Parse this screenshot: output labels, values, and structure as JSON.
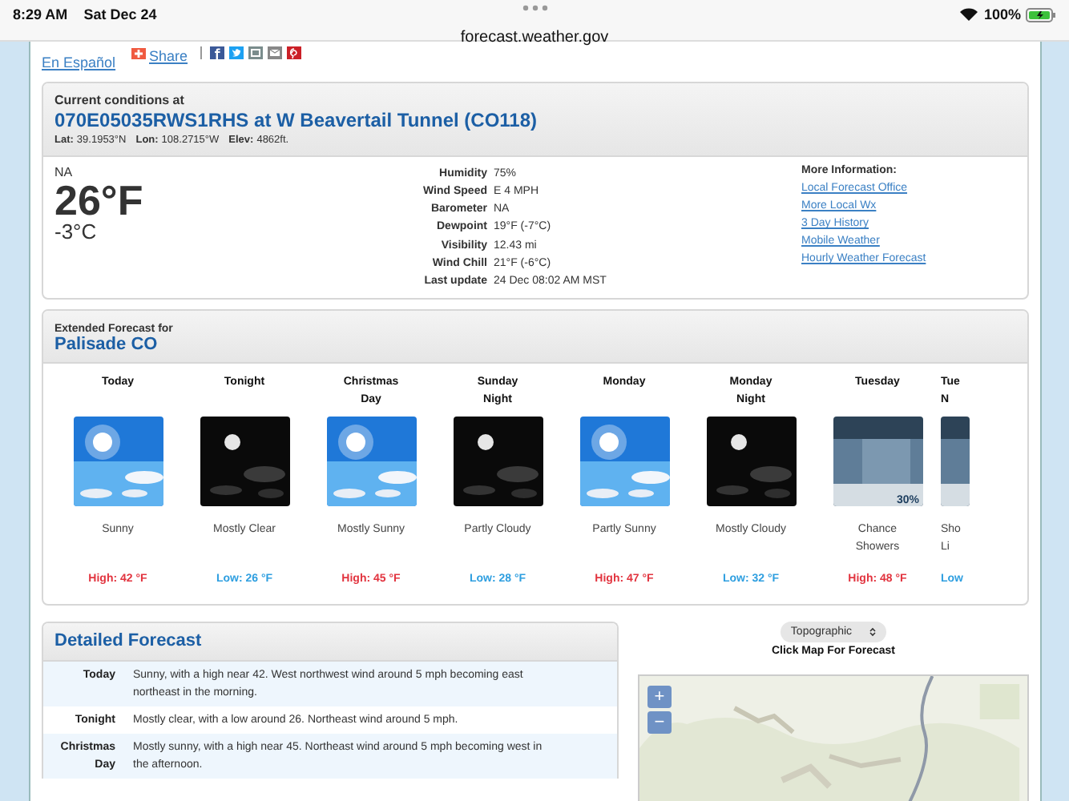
{
  "status_bar": {
    "time": "8:29 AM",
    "date": "Sat Dec 24",
    "battery": "100%",
    "url": "forecast.weather.gov"
  },
  "share": {
    "label": "Share"
  },
  "language_link": "En Español",
  "current_conditions": {
    "heading": "Current conditions at",
    "station": "070E05035RWS1RHS at W Beavertail Tunnel (CO118)",
    "location": [
      {
        "label": "Lat:",
        "value": "39.1953°N"
      },
      {
        "label": "Lon:",
        "value": "108.2715°W"
      },
      {
        "label": "Elev:",
        "value": "4862ft."
      }
    ],
    "condition": "NA",
    "temp_f": "26°F",
    "temp_c": "-3°C",
    "details": [
      {
        "label": "Humidity",
        "value": "75%"
      },
      {
        "label": "Wind Speed",
        "value": "E 4 MPH"
      },
      {
        "label": "Barometer",
        "value": "NA"
      },
      {
        "label": "Dewpoint",
        "value": "19°F (-7°C)"
      },
      {
        "label": "Visibility",
        "value": "12.43 mi"
      },
      {
        "label": "Wind Chill",
        "value": "21°F (-6°C)"
      },
      {
        "label": "Last update",
        "value": "24 Dec 08:02 AM MST"
      }
    ],
    "more_info": {
      "heading": "More Information:",
      "links": [
        "Local Forecast Office",
        "More Local Wx",
        "3 Day History",
        "Mobile Weather",
        "Hourly Weather Forecast"
      ]
    }
  },
  "extended_forecast": {
    "heading": "Extended Forecast for",
    "place": "Palisade CO",
    "periods": [
      {
        "name": [
          "Today"
        ],
        "kind": "day",
        "forecast": [
          "Sunny"
        ],
        "temp": "High: 42 °F",
        "color": "#e2343f"
      },
      {
        "name": [
          "Tonight"
        ],
        "kind": "night",
        "forecast": [
          "Mostly Clear"
        ],
        "temp": "Low: 26 °F",
        "color": "#2f9fe0"
      },
      {
        "name": [
          "Christmas",
          "Day"
        ],
        "kind": "day",
        "forecast": [
          "Mostly Sunny"
        ],
        "temp": "High: 45 °F",
        "color": "#e2343f"
      },
      {
        "name": [
          "Sunday",
          "Night"
        ],
        "kind": "night",
        "forecast": [
          "Partly Cloudy"
        ],
        "temp": "Low: 28 °F",
        "color": "#2f9fe0"
      },
      {
        "name": [
          "Monday"
        ],
        "kind": "day",
        "forecast": [
          "Partly Sunny"
        ],
        "temp": "High: 47 °F",
        "color": "#e2343f"
      },
      {
        "name": [
          "Monday",
          "Night"
        ],
        "kind": "night",
        "forecast": [
          "Mostly Cloudy"
        ],
        "temp": "Low: 32 °F",
        "color": "#2f9fe0"
      },
      {
        "name": [
          "Tuesday"
        ],
        "kind": "rain",
        "forecast": [
          "Chance",
          "Showers"
        ],
        "temp": "High: 48 °F",
        "color": "#e2343f",
        "chance": "30%"
      },
      {
        "name": [
          "Tue",
          "N"
        ],
        "kind": "rain",
        "forecast": [
          "Sho",
          "Li"
        ],
        "temp": "Low",
        "color": "#2f9fe0"
      }
    ]
  },
  "detailed_forecast": {
    "heading": "Detailed Forecast",
    "rows": [
      {
        "period": "Today",
        "text": "Sunny, with a high near 42. West northwest wind around 5 mph becoming east northeast in the morning."
      },
      {
        "period": "Tonight",
        "text": "Mostly clear, with a low around 26. Northeast wind around 5 mph."
      },
      {
        "period": "Christmas Day",
        "text": "Mostly sunny, with a high near 45. Northeast wind around 5 mph becoming west in the afternoon."
      }
    ]
  },
  "map": {
    "layer": "Topographic",
    "caption": "Click Map For Forecast",
    "zoom_in": "+",
    "zoom_out": "−"
  }
}
